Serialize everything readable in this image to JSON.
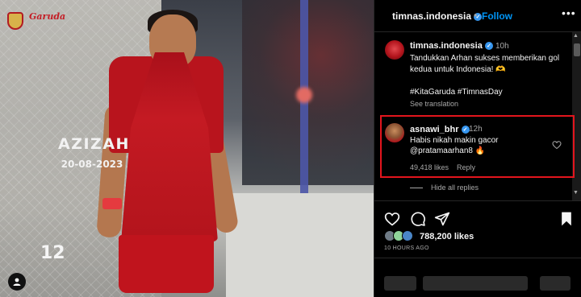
{
  "photo": {
    "logo_text": "Garuda",
    "jersey_name": "AZIZAH",
    "jersey_date": "20-08-2023",
    "shorts_number": "12"
  },
  "header": {
    "username": "timnas.indonesia",
    "separator": "•",
    "follow_label": "Follow",
    "more_label": "•••"
  },
  "caption": {
    "username": "timnas.indonesia",
    "time": "10h",
    "text": "Tandukkan Arhan sukses memberikan gol kedua untuk Indonesia! 🫶",
    "hashtags": "#KitaGaruda #TimnasDay",
    "see_translation": "See translation"
  },
  "comment": {
    "username": "asnawi_bhr",
    "time": "12h",
    "text": "Habis nikah makin gacor @pratamaarhan8 🔥",
    "likes": "49,418 likes",
    "reply_label": "Reply"
  },
  "hide_replies": "Hide all replies",
  "post": {
    "likes": "788,200 likes",
    "time_ago": "10 HOURS AGO"
  },
  "colors": {
    "accent_blue": "#0095f6",
    "verified_blue": "#3797f0",
    "highlight_red": "#e3151d",
    "jersey_red": "#b8141d"
  },
  "icons": {
    "like": "heart-icon",
    "comment": "comment-icon",
    "share": "share-icon",
    "save": "bookmark-icon",
    "tag": "user-tag-icon"
  }
}
